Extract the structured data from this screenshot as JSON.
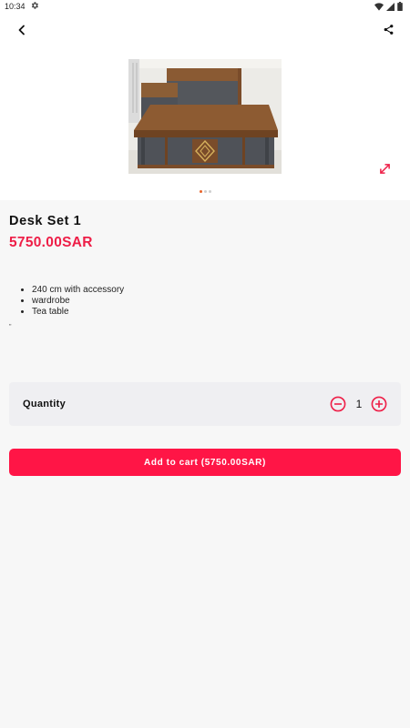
{
  "status_bar": {
    "time": "10:34",
    "icons": [
      "settings-icon",
      "wifi-icon",
      "signal-icon",
      "battery-icon"
    ]
  },
  "app_bar": {
    "back_icon": "chevron-left-icon",
    "share_icon": "share-icon"
  },
  "gallery": {
    "expand_icon": "expand-icon",
    "image_count": 3,
    "active_index": 0
  },
  "product": {
    "title": "Desk Set 1",
    "price": "5750.00SAR",
    "features": [
      "240 cm with accessory",
      "wardrobe",
      "Tea table"
    ],
    "stray_text": "\""
  },
  "quantity": {
    "label": "Quantity",
    "value": "1"
  },
  "cart": {
    "add_label": "Add to cart (5750.00SAR)"
  },
  "colors": {
    "accent": "#ff1546",
    "price": "#ee1e47",
    "background": "#f7f7f7",
    "panel": "#efeff2"
  }
}
